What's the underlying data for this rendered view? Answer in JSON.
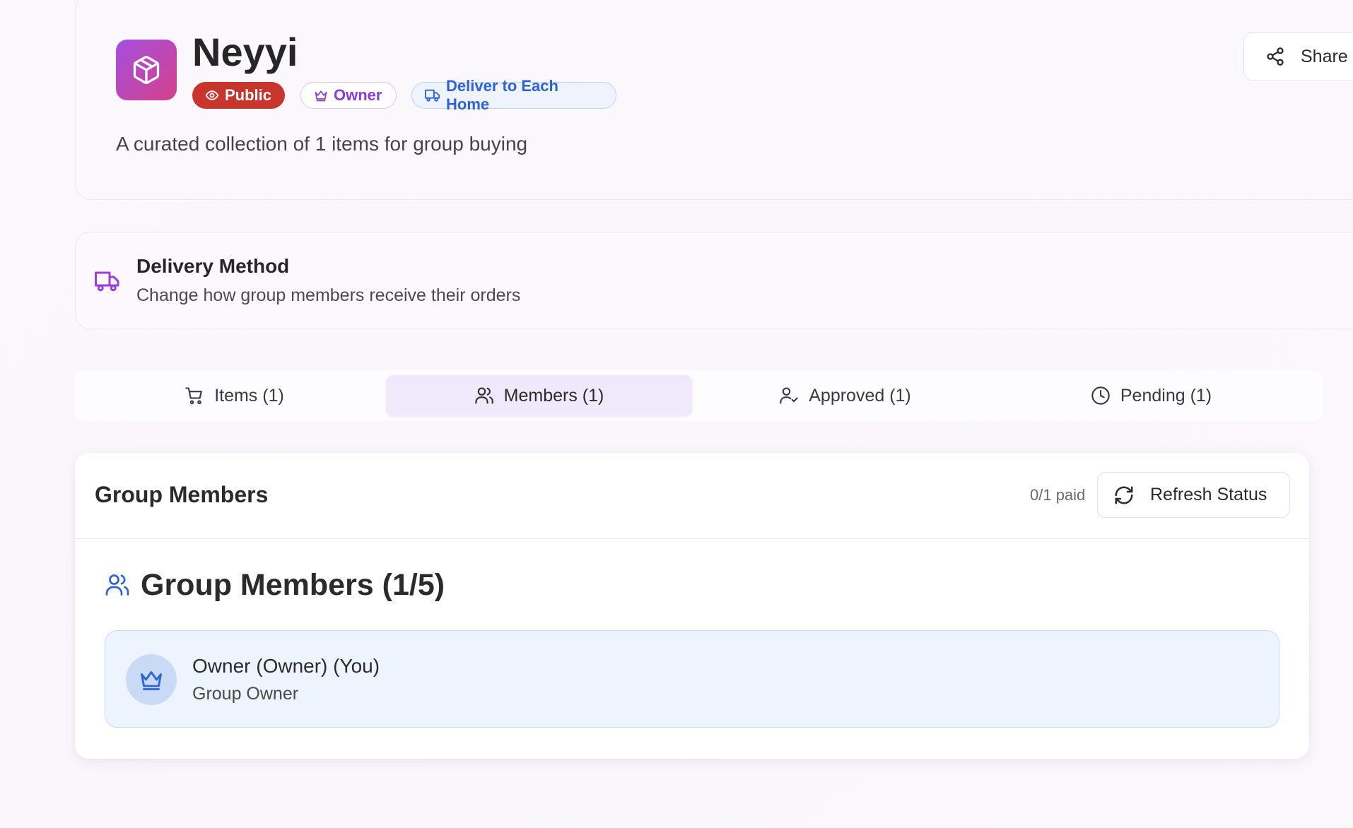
{
  "group": {
    "name": "Neyyi",
    "description": "A curated collection of 1 items for group buying",
    "logo_icon": "package-icon",
    "badges": {
      "visibility": "Public",
      "role": "Owner",
      "delivery": "Deliver to Each Home"
    },
    "share_label": "Share"
  },
  "delivery_method": {
    "title": "Delivery Method",
    "subtitle": "Change how group members receive their orders"
  },
  "tabs": [
    {
      "label": "Items (1)",
      "icon": "cart-icon",
      "active": false
    },
    {
      "label": "Members (1)",
      "icon": "users-icon",
      "active": true
    },
    {
      "label": "Approved (1)",
      "icon": "user-check-icon",
      "active": false
    },
    {
      "label": "Pending (1)",
      "icon": "clock-icon",
      "active": false
    }
  ],
  "members_panel": {
    "title": "Group Members",
    "paid_status": "0/1 paid",
    "refresh_label": "Refresh Status",
    "heading": "Group Members (1/5)",
    "members": [
      {
        "name": "Owner (Owner) (You)",
        "role": "Group Owner",
        "icon": "crown-icon"
      }
    ]
  },
  "colors": {
    "public_badge": "#c8352c",
    "owner_badge_text": "#8a3bd6",
    "delivery_badge_text": "#2f62d8",
    "active_tab_bg": "#f0e8fb",
    "member_row_bg": "#eef4fe",
    "accent_purple": "#9b3fd8",
    "accent_blue": "#2f62d8"
  }
}
